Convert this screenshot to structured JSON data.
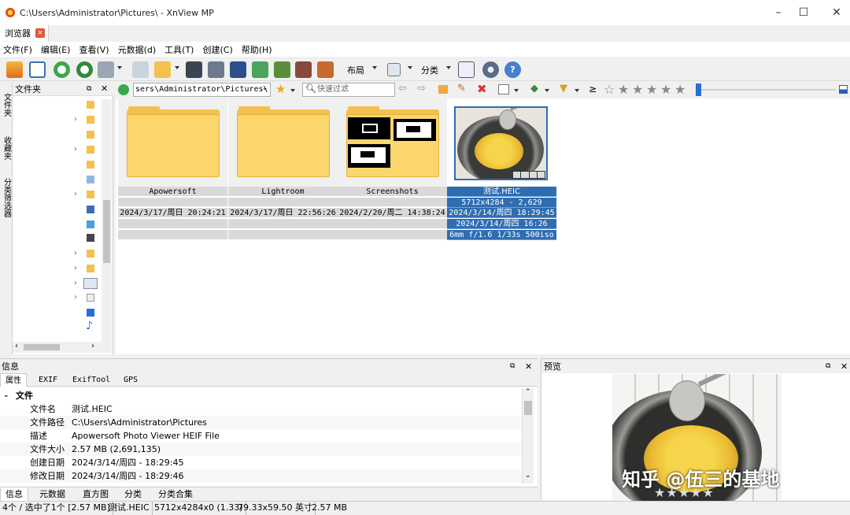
{
  "window": {
    "title": "C:\\Users\\Administrator\\Pictures\\ - XnView MP"
  },
  "tabs": [
    {
      "label": "浏览器",
      "close": "×"
    }
  ],
  "menu": [
    "文件(F)",
    "编辑(E)",
    "查看(V)",
    "元数据(d)",
    "工具(T)",
    "创建(C)",
    "帮助(H)"
  ],
  "toolbar": {
    "layout_label": "布局",
    "sort_label": "分类"
  },
  "left_vtabs": [
    "文件夹",
    "收藏夹",
    "分类筛选器"
  ],
  "folder_panel": {
    "title": "文件夹"
  },
  "addressbar": {
    "path": "sers\\Administrator\\Pictures\\",
    "filter_placeholder": "快速过滤",
    "rating_op": "≥"
  },
  "thumbnails": [
    {
      "name": "Apowersoft",
      "date": "2024/3/17/周日 20:24:21",
      "type": "folder"
    },
    {
      "name": "Lightroom",
      "date": "2024/3/17/周日 22:56:26",
      "type": "folder"
    },
    {
      "name": "Screenshots",
      "date": "2024/2/20/周二 14:38:24",
      "type": "folder"
    },
    {
      "name": "测试.HEIC",
      "type": "image",
      "selected": true,
      "dims": "5712x4284 - 2,629",
      "date1": "2024/3/14/周四 18:29:45",
      "date2": "2024/3/14/周四 16:26",
      "exif": "6mm f/1.6 1/33s 500iso"
    }
  ],
  "info_panel": {
    "title": "信息",
    "tabs": [
      "属性",
      "EXIF",
      "ExifTool",
      "GPS"
    ],
    "section": "文件",
    "rows": [
      {
        "k": "文件名",
        "v": "测试.HEIC"
      },
      {
        "k": "文件路径",
        "v": "C:\\Users\\Administrator\\Pictures"
      },
      {
        "k": "描述",
        "v": "Apowersoft Photo Viewer HEIF File"
      },
      {
        "k": "文件大小",
        "v": "2.57 MB (2,691,135)"
      },
      {
        "k": "创建日期",
        "v": "2024/3/14/周四 - 18:29:45"
      },
      {
        "k": "修改日期",
        "v": "2024/3/14/周四 - 18:29:46"
      }
    ],
    "bottom_tabs": [
      "信息",
      "元数据",
      "直方图",
      "分类",
      "分类合集"
    ]
  },
  "preview_panel": {
    "title": "预览"
  },
  "watermark": "知乎 @伍三的基地",
  "statusbar": [
    "4个 / 选中了1个 [2.57 MB]",
    "测试.HEIC",
    "5712x4284x0 (1.33)",
    "79.33x59.50 英寸",
    "2.57 MB"
  ],
  "colors": {
    "selection": "#2f6db3",
    "folder": "#f2c14e",
    "accent": "#2a6fd6"
  }
}
